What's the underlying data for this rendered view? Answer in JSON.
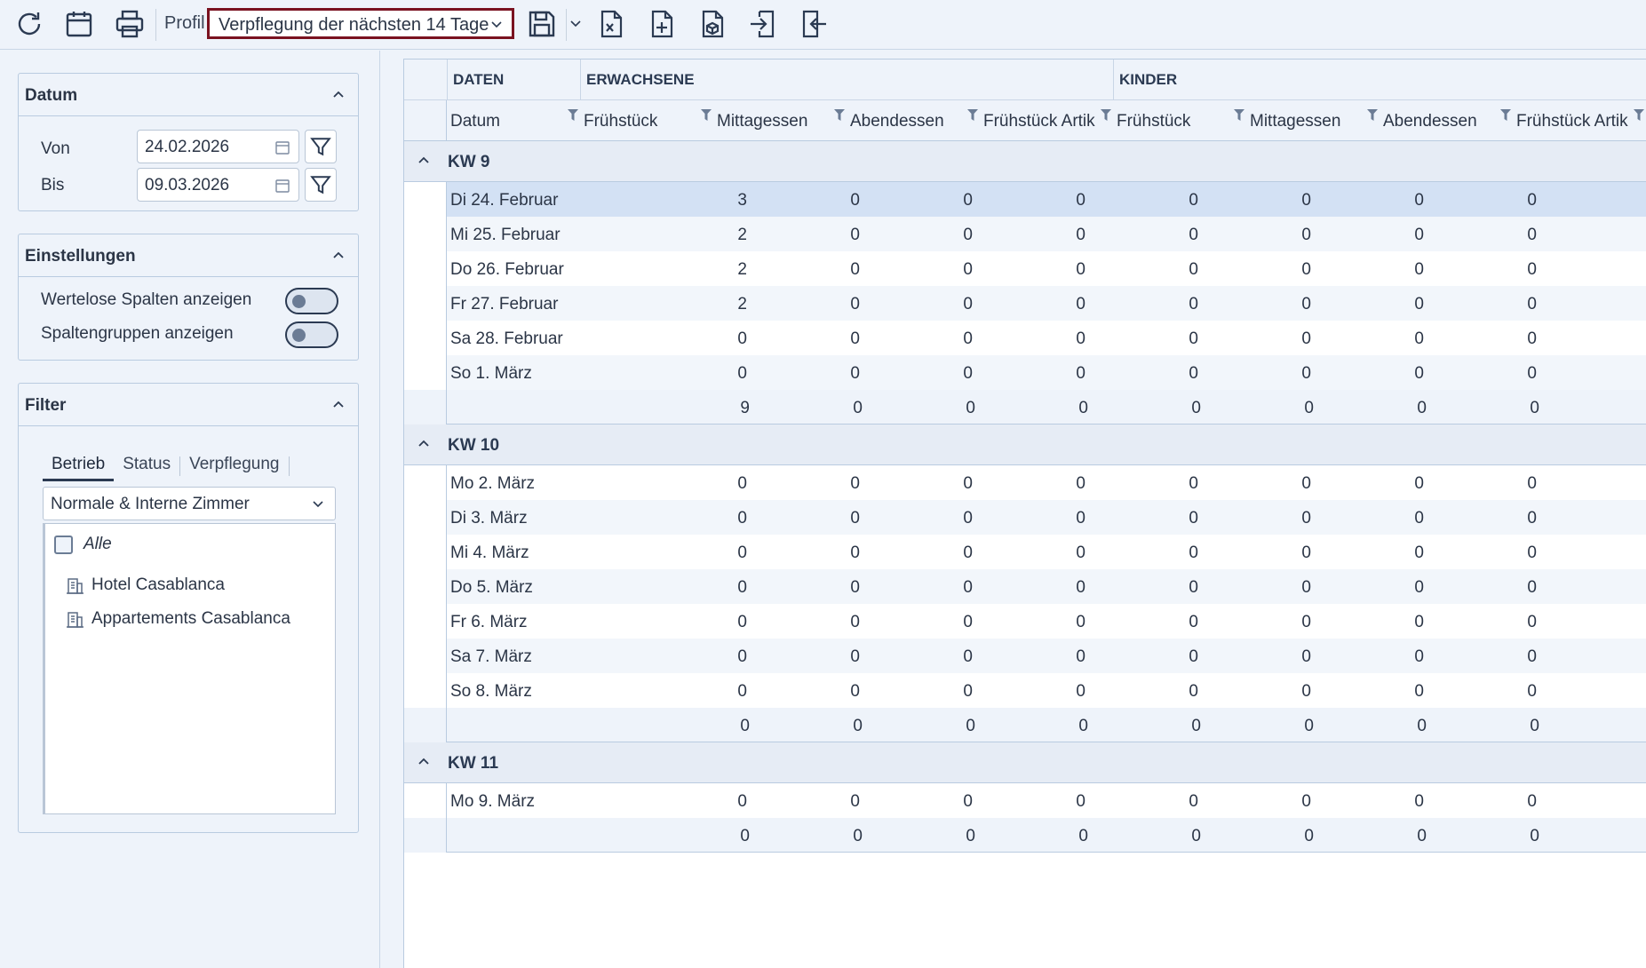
{
  "toolbar": {
    "icons": [
      "refresh-icon",
      "calendar-icon",
      "print-icon",
      "save-icon",
      "export-excel-icon",
      "new-document-icon",
      "package-icon",
      "import-icon",
      "export-icon"
    ],
    "profil_label": "Profil",
    "profil_value": "Verpflegung der nächsten 14 Tage"
  },
  "sidebar": {
    "datum": {
      "title": "Datum",
      "von_label": "Von",
      "von_value": "24.02.2026",
      "bis_label": "Bis",
      "bis_value": "09.03.2026"
    },
    "einstellungen": {
      "title": "Einstellungen",
      "wertelose_label": "Wertelose Spalten anzeigen",
      "spaltengruppen_label": "Spaltengruppen anzeigen"
    },
    "filter": {
      "title": "Filter",
      "tabs": [
        "Betrieb",
        "Status",
        "Verpflegung"
      ],
      "combo_value": "Normale & Interne Zimmer",
      "items": [
        "Alle",
        "Hotel Casablanca",
        "Appartements Casablanca"
      ]
    }
  },
  "grid": {
    "group_headers": [
      "DATEN",
      "ERWACHSENE",
      "KINDER"
    ],
    "columns": [
      "Datum",
      "Frühstück",
      "Mittagessen",
      "Abendessen",
      "Frühstück Artik",
      "Frühstück",
      "Mittagessen",
      "Abendessen",
      "Frühstück Artik"
    ],
    "groups": [
      {
        "label": "KW 9",
        "rows": [
          {
            "date": "Di 24. Februar",
            "values": [
              "3",
              "0",
              "0",
              "0",
              "0",
              "0",
              "0",
              "0"
            ]
          },
          {
            "date": "Mi 25. Februar",
            "values": [
              "2",
              "0",
              "0",
              "0",
              "0",
              "0",
              "0",
              "0"
            ]
          },
          {
            "date": "Do 26. Februar",
            "values": [
              "2",
              "0",
              "0",
              "0",
              "0",
              "0",
              "0",
              "0"
            ]
          },
          {
            "date": "Fr 27. Februar",
            "values": [
              "2",
              "0",
              "0",
              "0",
              "0",
              "0",
              "0",
              "0"
            ]
          },
          {
            "date": "Sa 28. Februar",
            "values": [
              "0",
              "0",
              "0",
              "0",
              "0",
              "0",
              "0",
              "0"
            ]
          },
          {
            "date": "So 1. März",
            "values": [
              "0",
              "0",
              "0",
              "0",
              "0",
              "0",
              "0",
              "0"
            ]
          }
        ],
        "sum": [
          "9",
          "0",
          "0",
          "0",
          "0",
          "0",
          "0",
          "0"
        ]
      },
      {
        "label": "KW 10",
        "rows": [
          {
            "date": "Mo 2. März",
            "values": [
              "0",
              "0",
              "0",
              "0",
              "0",
              "0",
              "0",
              "0"
            ]
          },
          {
            "date": "Di 3. März",
            "values": [
              "0",
              "0",
              "0",
              "0",
              "0",
              "0",
              "0",
              "0"
            ]
          },
          {
            "date": "Mi 4. März",
            "values": [
              "0",
              "0",
              "0",
              "0",
              "0",
              "0",
              "0",
              "0"
            ]
          },
          {
            "date": "Do 5. März",
            "values": [
              "0",
              "0",
              "0",
              "0",
              "0",
              "0",
              "0",
              "0"
            ]
          },
          {
            "date": "Fr 6. März",
            "values": [
              "0",
              "0",
              "0",
              "0",
              "0",
              "0",
              "0",
              "0"
            ]
          },
          {
            "date": "Sa 7. März",
            "values": [
              "0",
              "0",
              "0",
              "0",
              "0",
              "0",
              "0",
              "0"
            ]
          },
          {
            "date": "So 8. März",
            "values": [
              "0",
              "0",
              "0",
              "0",
              "0",
              "0",
              "0",
              "0"
            ]
          }
        ],
        "sum": [
          "0",
          "0",
          "0",
          "0",
          "0",
          "0",
          "0",
          "0"
        ]
      },
      {
        "label": "KW 11",
        "rows": [
          {
            "date": "Mo 9. März",
            "values": [
              "0",
              "0",
              "0",
              "0",
              "0",
              "0",
              "0",
              "0"
            ]
          }
        ],
        "sum": [
          "0",
          "0",
          "0",
          "0",
          "0",
          "0",
          "0",
          "0"
        ]
      }
    ]
  }
}
